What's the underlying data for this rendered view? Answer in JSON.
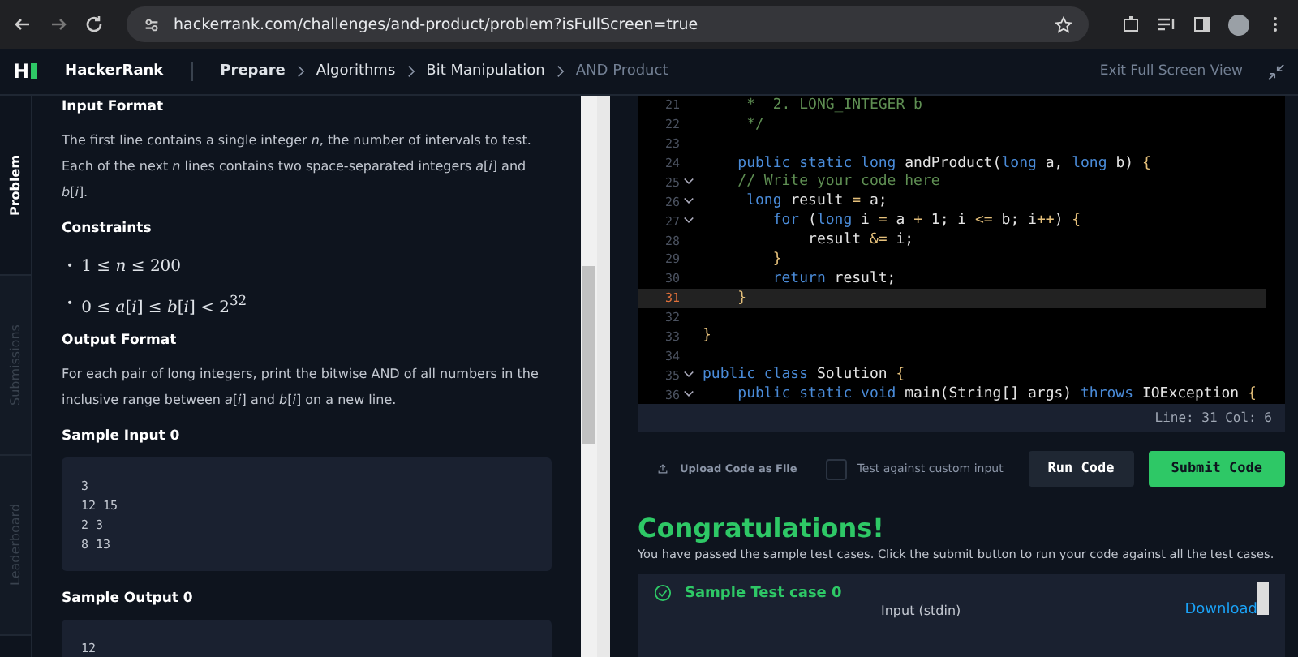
{
  "browser": {
    "url": "hackerrank.com/challenges/and-product/problem?isFullScreen=true"
  },
  "header": {
    "logo_mark": "H",
    "brand": "HackerRank",
    "breadcrumbs": [
      {
        "label": "Prepare",
        "current": false,
        "bold": true
      },
      {
        "label": "Algorithms",
        "current": false,
        "bold": false
      },
      {
        "label": "Bit Manipulation",
        "current": false,
        "bold": false
      },
      {
        "label": "AND Product",
        "current": true,
        "bold": false
      }
    ],
    "exit_label": "Exit Full Screen View"
  },
  "side_tabs": [
    {
      "label": "Problem",
      "selected": true
    },
    {
      "label": "Submissions",
      "selected": false
    },
    {
      "label": "Leaderboard",
      "selected": false
    }
  ],
  "problem": {
    "sections": [
      {
        "kind": "heading",
        "text": "Input Format"
      },
      {
        "kind": "para",
        "text": "The first line contains a single integer *n*, the number of intervals to test. Each of the next *n* lines contains two space-separated integers *a*[*i*] and *b*[*i*]."
      },
      {
        "kind": "heading",
        "text": "Constraints"
      },
      {
        "kind": "bullets",
        "items": [
          {
            "marker": "•",
            "text": "1 ≤ *n* ≤ 200"
          },
          {
            "marker": "•",
            "text": "0 ≤ *a*[*i*] ≤ *b*[*i*] < 2$^{32}$"
          }
        ]
      },
      {
        "kind": "heading",
        "text": "Output Format"
      },
      {
        "kind": "para",
        "text": "For each pair of long integers, print the bitwise AND of all numbers in the inclusive range between *a*[*i*] and *b*[*i*] on a new line."
      },
      {
        "kind": "heading",
        "text": "Sample Input 0"
      },
      {
        "kind": "code",
        "lines": [
          "3",
          "12 15",
          "2 3",
          "8 13"
        ]
      },
      {
        "kind": "heading",
        "text": "Sample Output 0"
      },
      {
        "kind": "code",
        "lines": [
          "12"
        ]
      }
    ]
  },
  "editor": {
    "lines": [
      {
        "number": "21",
        "fold": false,
        "current": false,
        "tokens": [
          {
            "kind": "comment",
            "text": "     *  2. LONG_INTEGER b"
          }
        ]
      },
      {
        "number": "22",
        "fold": false,
        "current": false,
        "tokens": [
          {
            "kind": "comment",
            "text": "     */"
          }
        ]
      },
      {
        "number": "23",
        "fold": false,
        "current": false
      },
      {
        "number": "24",
        "fold": false,
        "current": false,
        "tokens": [
          {
            "kind": "kw",
            "text": "    public static long "
          },
          {
            "kind": "plain",
            "text": "andProduct("
          },
          {
            "kind": "kw",
            "text": "long "
          },
          {
            "kind": "plain",
            "text": "a, "
          },
          {
            "kind": "kw",
            "text": "long "
          },
          {
            "kind": "plain",
            "text": "b) "
          },
          {
            "kind": "brace",
            "text": "{"
          }
        ]
      },
      {
        "number": "25",
        "fold": true,
        "current": false,
        "tokens": [
          {
            "kind": "comment",
            "text": "    // Write your code here"
          }
        ]
      },
      {
        "number": "26",
        "fold": true,
        "current": false,
        "tokens": [
          {
            "kind": "kw",
            "text": "     long "
          },
          {
            "kind": "plain",
            "text": "result "
          },
          {
            "kind": "brace",
            "text": "= "
          },
          {
            "kind": "plain",
            "text": "a;"
          }
        ]
      },
      {
        "number": "27",
        "fold": true,
        "current": false,
        "tokens": [
          {
            "kind": "kw",
            "text": "        for "
          },
          {
            "kind": "plain",
            "text": "("
          },
          {
            "kind": "kw",
            "text": "long "
          },
          {
            "kind": "plain",
            "text": "i "
          },
          {
            "kind": "brace",
            "text": "= "
          },
          {
            "kind": "plain",
            "text": "a "
          },
          {
            "kind": "brace",
            "text": "+ "
          },
          {
            "kind": "plain",
            "text": "1; i "
          },
          {
            "kind": "brace",
            "text": "<= "
          },
          {
            "kind": "plain",
            "text": "b; i"
          },
          {
            "kind": "brace",
            "text": "++"
          },
          {
            "kind": "plain",
            "text": ") "
          },
          {
            "kind": "brace",
            "text": "{"
          }
        ]
      },
      {
        "number": "28",
        "fold": false,
        "current": false,
        "tokens": [
          {
            "kind": "plain",
            "text": "            result "
          },
          {
            "kind": "brace",
            "text": "&= "
          },
          {
            "kind": "plain",
            "text": "i;"
          }
        ]
      },
      {
        "number": "29",
        "fold": false,
        "current": false,
        "tokens": [
          {
            "kind": "brace",
            "text": "        }"
          }
        ]
      },
      {
        "number": "30",
        "fold": false,
        "current": false,
        "tokens": [
          {
            "kind": "kw",
            "text": "        return "
          },
          {
            "kind": "plain",
            "text": "result;"
          }
        ]
      },
      {
        "number": "31",
        "fold": false,
        "current": true,
        "tokens": [
          {
            "kind": "brace",
            "text": "    }"
          }
        ]
      },
      {
        "number": "32",
        "fold": false,
        "current": false
      },
      {
        "number": "33",
        "fold": false,
        "current": false,
        "tokens": [
          {
            "kind": "brace",
            "text": "}"
          }
        ]
      },
      {
        "number": "34",
        "fold": false,
        "current": false
      },
      {
        "number": "35",
        "fold": true,
        "current": false,
        "tokens": [
          {
            "kind": "kw",
            "text": "public class "
          },
          {
            "kind": "plain",
            "text": "Solution "
          },
          {
            "kind": "brace",
            "text": "{"
          }
        ]
      },
      {
        "number": "36",
        "fold": true,
        "current": false,
        "tokens": [
          {
            "kind": "kw",
            "text": "    public static void "
          },
          {
            "kind": "plain",
            "text": "main(String[] args) "
          },
          {
            "kind": "kw",
            "text": "throws "
          },
          {
            "kind": "plain",
            "text": "IOException "
          },
          {
            "kind": "brace",
            "text": "{"
          }
        ]
      }
    ],
    "status": "Line: 31 Col: 6"
  },
  "actions": {
    "upload": "Upload Code as File",
    "custom_input": {
      "label": "Test against custom input",
      "checked": false
    },
    "run": "Run Code",
    "submit": "Submit Code"
  },
  "result": {
    "title": "Congratulations!",
    "message": "You have passed the sample test cases. Click the submit button to run your code against all the test cases.",
    "test_case": "Sample Test case 0",
    "input_label": "Input (stdin)",
    "download": "Download"
  }
}
